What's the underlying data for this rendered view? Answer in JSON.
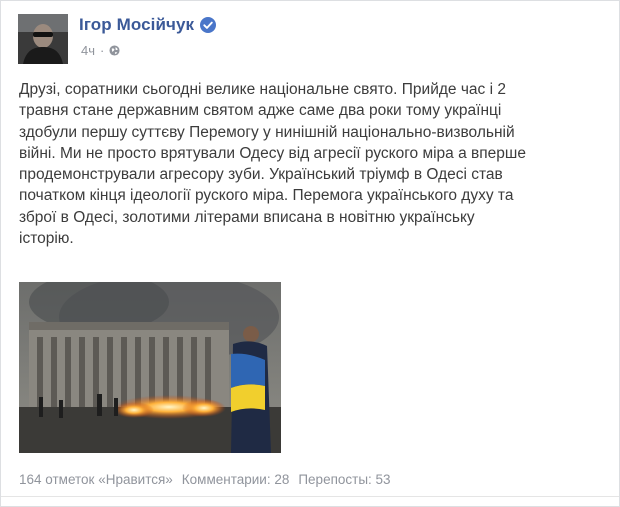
{
  "post": {
    "author": "Ігор Мосійчук",
    "time": "4ч",
    "text": "Друзі, соратники сьогодні велике національне свято. Прийде час і 2\nтравня стане державним святом адже саме два роки тому українці\nздобули першу суттєву Перемогу у нинішній національно-визвольній\nвійні. Ми не просто врятували Одесу від агресії руского міра а вперше\nпродемонстрували агресору зуби. Український тріумф в Одесі став\nпочатком кінця ідеології руского міра. Перемога українського духу та\nзброї в Одесі, золотими літерами вписана в новітню українську\nісторію."
  },
  "stats": {
    "likes": "164 отметок «Нравится»",
    "comments": "Комментарии: 28",
    "shares": "Перепосты: 53"
  },
  "icons": {
    "verified": "verified-badge-icon",
    "audience": "globe-icon"
  },
  "colors": {
    "author_link": "#3b5998",
    "meta_text": "#90949c",
    "body_text": "#3c3c3c",
    "verified_badge": "#4a76c9"
  }
}
